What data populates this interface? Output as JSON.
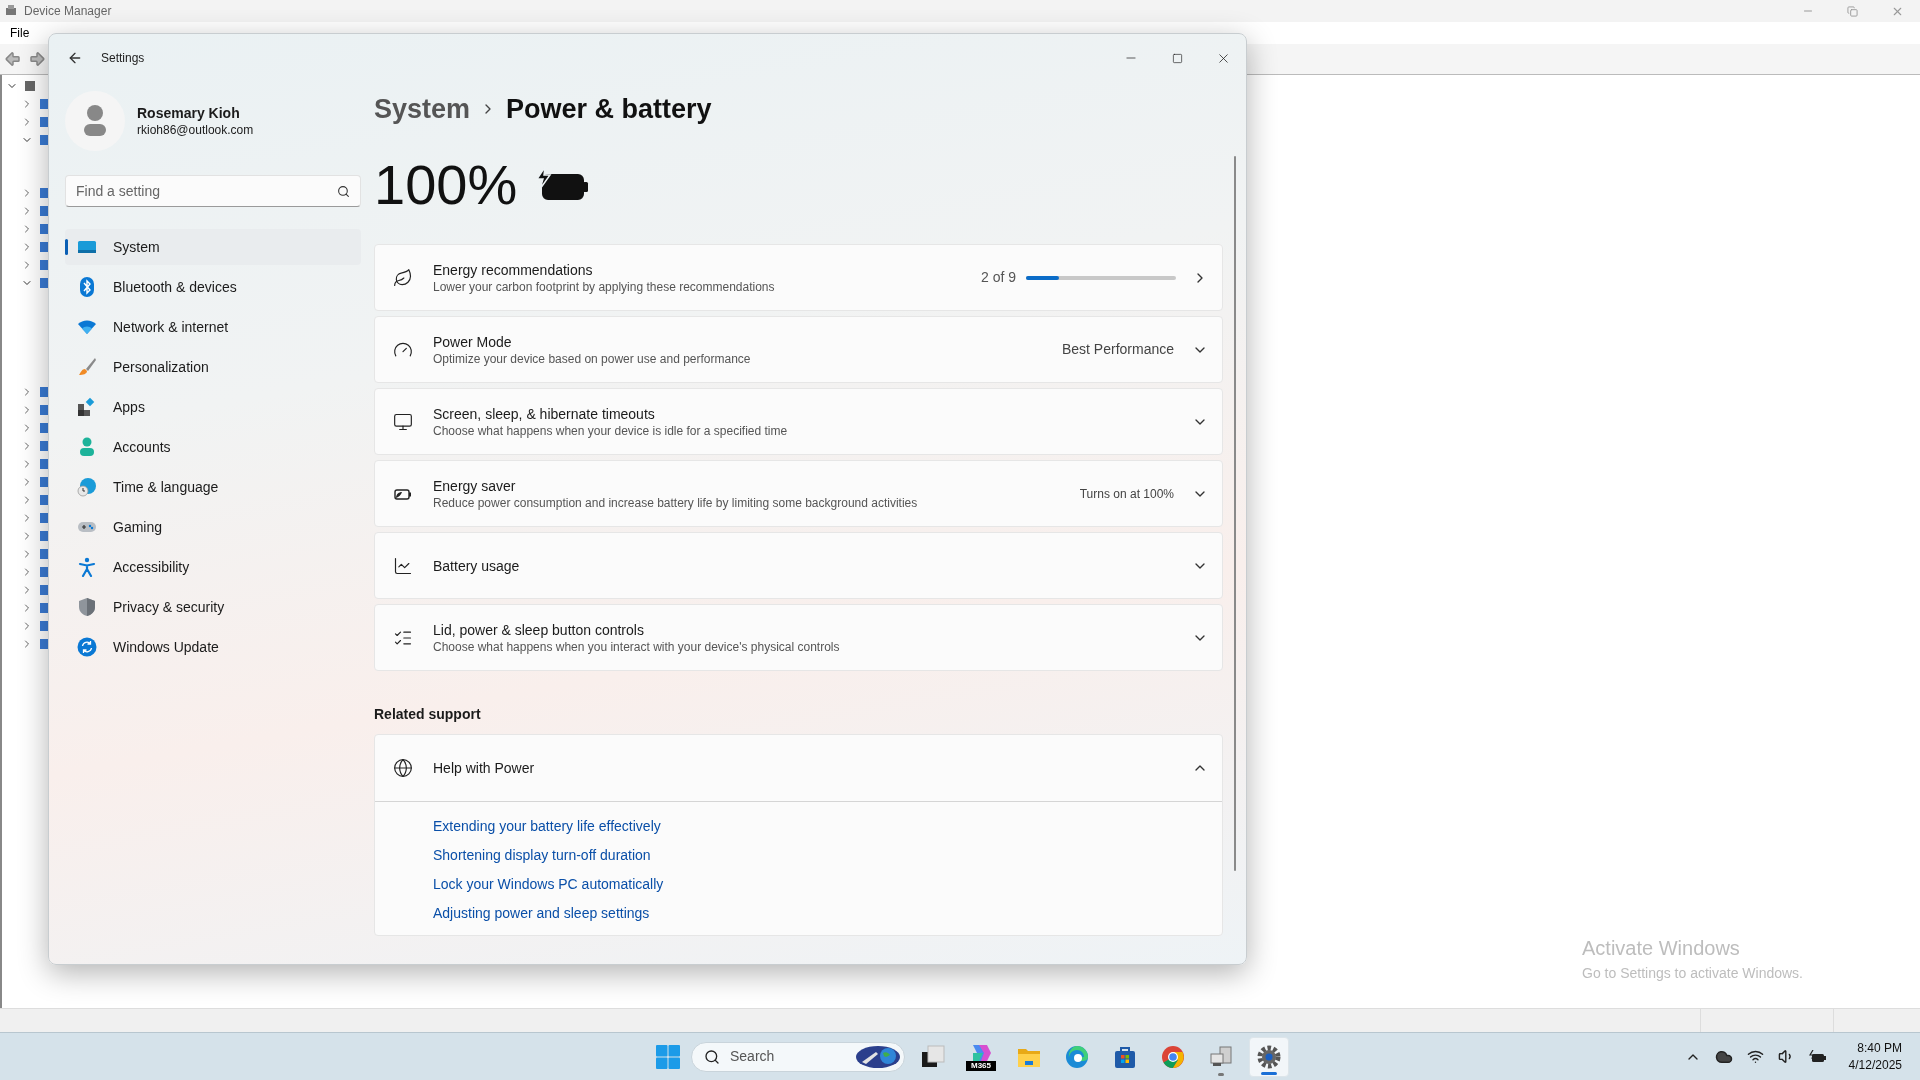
{
  "background_window": {
    "title": "Device Manager",
    "menu": [
      "File"
    ],
    "tree": [
      {
        "expanded": true,
        "children": [
          {
            "expanded": false
          },
          {
            "expanded": false
          },
          {
            "expanded": true
          },
          {
            "expanded": false
          },
          {
            "expanded": false
          },
          {
            "expanded": false
          },
          {
            "expanded": false
          },
          {
            "expanded": false
          },
          {
            "expanded": true
          },
          {
            "expanded": false
          },
          {
            "expanded": false
          },
          {
            "expanded": false
          },
          {
            "expanded": false
          },
          {
            "expanded": false
          },
          {
            "expanded": false
          },
          {
            "expanded": false
          },
          {
            "expanded": false
          },
          {
            "expanded": false
          },
          {
            "expanded": false
          },
          {
            "expanded": false
          },
          {
            "expanded": false
          },
          {
            "expanded": false
          },
          {
            "expanded": false
          },
          {
            "expanded": false
          }
        ]
      }
    ]
  },
  "settings": {
    "title": "Settings",
    "user": {
      "name": "Rosemary Kioh",
      "email": "rkioh86@outlook.com"
    },
    "search": {
      "placeholder": "Find a setting"
    },
    "nav": [
      {
        "label": "System",
        "kind": "system",
        "selected": true
      },
      {
        "label": "Bluetooth & devices",
        "kind": "bluetooth",
        "selected": false
      },
      {
        "label": "Network & internet",
        "kind": "network",
        "selected": false
      },
      {
        "label": "Personalization",
        "kind": "personalization",
        "selected": false
      },
      {
        "label": "Apps",
        "kind": "apps",
        "selected": false
      },
      {
        "label": "Accounts",
        "kind": "accounts",
        "selected": false
      },
      {
        "label": "Time & language",
        "kind": "time",
        "selected": false
      },
      {
        "label": "Gaming",
        "kind": "gaming",
        "selected": false
      },
      {
        "label": "Accessibility",
        "kind": "accessibility",
        "selected": false
      },
      {
        "label": "Privacy & security",
        "kind": "privacy",
        "selected": false
      },
      {
        "label": "Windows Update",
        "kind": "update",
        "selected": false
      }
    ],
    "breadcrumb": {
      "parent": "System",
      "current": "Power & battery"
    },
    "battery": {
      "percent": "100%",
      "charging": true
    },
    "cards": [
      {
        "kind": "energy",
        "title": "Energy recommendations",
        "description": "Lower your carbon footprint by applying these recommendations",
        "progress_text": "2 of 9",
        "level": 0.22
      },
      {
        "kind": "power_mode",
        "title": "Power Mode",
        "description": "Optimize your device based on power use and performance",
        "value": "Best Performance",
        "expanded": false
      },
      {
        "kind": "screen",
        "title": "Screen, sleep, & hibernate timeouts",
        "description": "Choose what happens when your device is idle for a specified time",
        "expanded": false
      },
      {
        "kind": "saver",
        "title": "Energy saver",
        "description": "Reduce power consumption and increase battery life by limiting some background activities",
        "note": "Turns on at 100%",
        "expanded": false
      },
      {
        "kind": "usage",
        "title": "Battery usage",
        "expanded": false
      },
      {
        "kind": "lid",
        "title": "Lid, power & sleep button controls",
        "description": "Choose what happens when you interact with your device's physical controls",
        "expanded": false
      }
    ],
    "related": {
      "heading": "Related support",
      "title": "Help with Power",
      "expanded": true,
      "links": [
        "Extending your battery life effectively",
        "Shortening display turn-off duration",
        "Lock your Windows PC automatically",
        "Adjusting power and sleep settings"
      ]
    }
  },
  "activation_notice": {
    "title": "Activate Windows",
    "subtitle": "Go to Settings to activate Windows."
  },
  "taskbar": {
    "search_placeholder": "Search",
    "apps": [
      {
        "kind": "task_view",
        "selected": false,
        "running": false
      },
      {
        "kind": "m365",
        "badge": "M365",
        "selected": false,
        "running": false
      },
      {
        "kind": "explorer",
        "selected": false,
        "running": false
      },
      {
        "kind": "edge",
        "selected": false,
        "running": false
      },
      {
        "kind": "store",
        "selected": false,
        "running": false
      },
      {
        "kind": "chrome",
        "selected": false,
        "running": false
      },
      {
        "kind": "device_manager",
        "selected": false,
        "running": true
      },
      {
        "kind": "settings",
        "selected": true,
        "running": true
      }
    ],
    "clock": {
      "time": "8:40 PM",
      "date": "4/12/2025"
    }
  }
}
